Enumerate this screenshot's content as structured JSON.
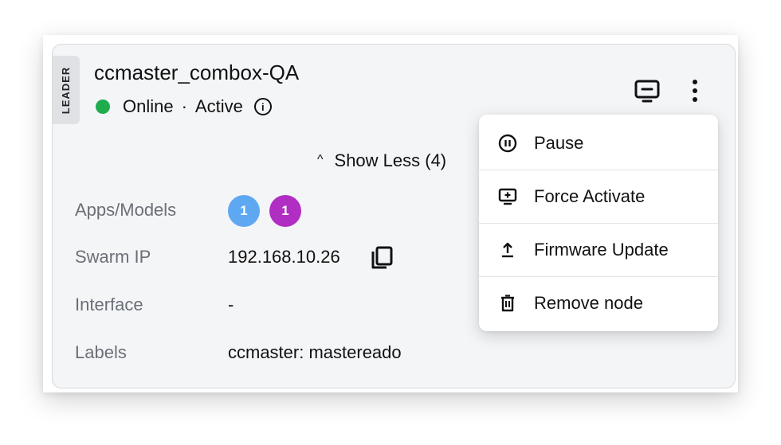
{
  "node": {
    "leader_tag": "LEADER",
    "name": "ccmaster_combox-QA",
    "status": "Online",
    "separator": "·",
    "state": "Active",
    "status_color": "#1fac4f"
  },
  "toggle": {
    "label": "Show Less (4)"
  },
  "details": {
    "apps_models": {
      "label": "Apps/Models",
      "badges": [
        {
          "count": "1",
          "color": "#5ea8f2"
        },
        {
          "count": "1",
          "color": "#b12ec2"
        }
      ]
    },
    "swarm_ip": {
      "label": "Swarm IP",
      "value": "192.168.10.26"
    },
    "interface": {
      "label": "Interface",
      "value": "-"
    },
    "labels": {
      "label": "Labels",
      "value": "ccmaster: mastereado"
    }
  },
  "menu": {
    "items": [
      {
        "label": "Pause",
        "icon": "pause-circle-icon"
      },
      {
        "label": "Force Activate",
        "icon": "monitor-plus-icon"
      },
      {
        "label": "Firmware Update",
        "icon": "upload-arrow-icon"
      },
      {
        "label": "Remove node",
        "icon": "trash-icon"
      }
    ]
  }
}
